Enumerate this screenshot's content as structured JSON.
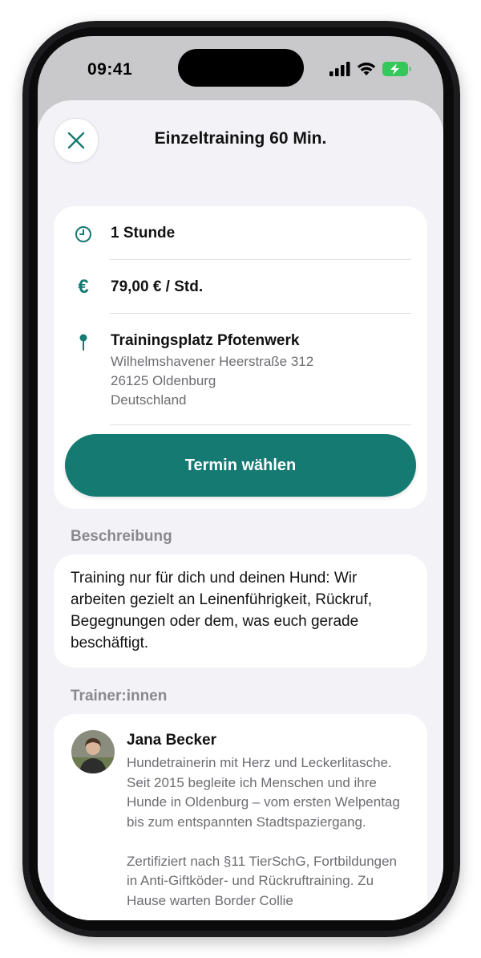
{
  "status_bar": {
    "time": "09:41"
  },
  "sheet": {
    "title": "Einzeltraining 60 Min."
  },
  "info": {
    "duration": "1 Stunde",
    "price": "79,00 € / Std.",
    "location_name": "Trainingsplatz Pfotenwerk",
    "address_line1": "Wilhelmshavener Heerstraße 312",
    "address_line2": "26125 Oldenburg",
    "address_line3": "Deutschland",
    "cta_label": "Termin wählen"
  },
  "description": {
    "heading": "Beschreibung",
    "text": "Training nur für dich und deinen Hund: Wir arbeiten gezielt an Leinenführigkeit, Rückruf, Begegnungen oder dem, was euch gerade beschäftigt."
  },
  "trainers": {
    "heading": "Trainer:innen",
    "items": [
      {
        "name": "Jana Becker",
        "bio_p1": "Hundetrainerin mit Herz und Leckerli­tasche. Seit 2015 begleite ich Menschen und ihre Hunde in Oldenburg – vom ersten Welpentag bis zum entspannten Stadt­spaziergang.",
        "bio_p2": "Zertifiziert nach §11 TierSchG, Fort­bildungen in Anti-Giftköder- und Rückruf­training. Zu Hause warten Border Collie"
      }
    ]
  },
  "colors": {
    "accent": "#157a72",
    "battery": "#34c759"
  },
  "icons": [
    "close-icon",
    "clock-icon",
    "euro-icon",
    "location-pin-icon",
    "signal-icon",
    "wifi-icon",
    "battery-charging-icon"
  ]
}
